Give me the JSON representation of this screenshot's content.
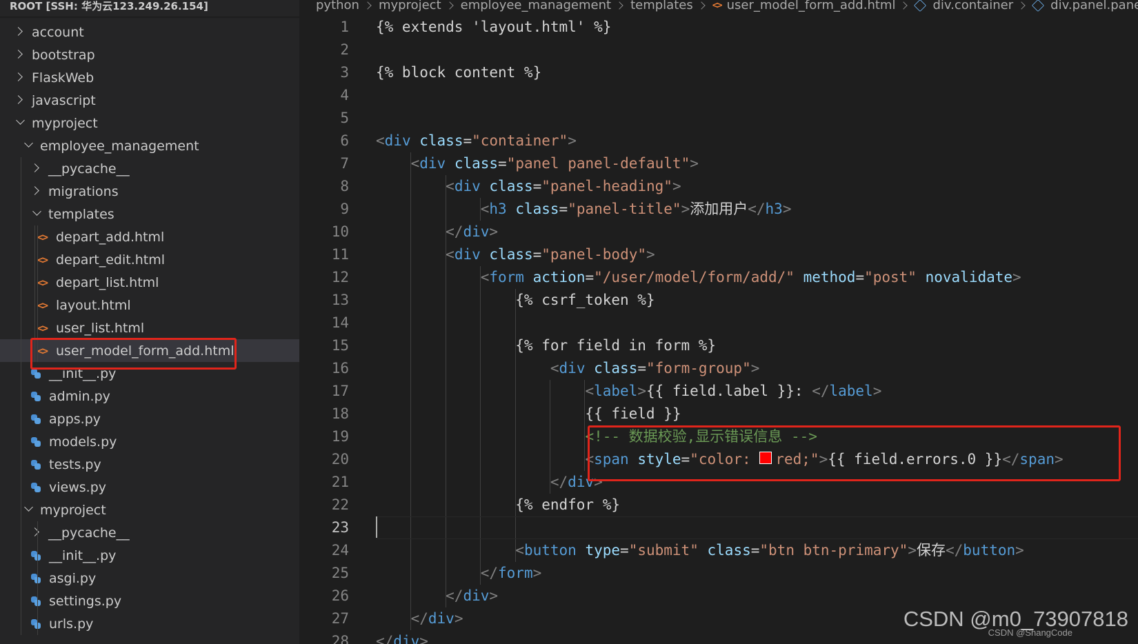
{
  "explorer": {
    "root_title": "ROOT [SSH: 华为云123.249.26.154]",
    "items": [
      {
        "label": "account",
        "kind": "folder",
        "state": "closed",
        "depth": 0
      },
      {
        "label": "bootstrap",
        "kind": "folder",
        "state": "closed",
        "depth": 0
      },
      {
        "label": "FlaskWeb",
        "kind": "folder",
        "state": "closed",
        "depth": 0
      },
      {
        "label": "javascript",
        "kind": "folder",
        "state": "closed",
        "depth": 0
      },
      {
        "label": "myproject",
        "kind": "folder",
        "state": "open",
        "depth": 0
      },
      {
        "label": "employee_management",
        "kind": "folder",
        "state": "open",
        "depth": 1
      },
      {
        "label": "__pycache__",
        "kind": "folder",
        "state": "closed",
        "depth": 2
      },
      {
        "label": "migrations",
        "kind": "folder",
        "state": "closed",
        "depth": 2
      },
      {
        "label": "templates",
        "kind": "folder",
        "state": "open",
        "depth": 2
      },
      {
        "label": "depart_add.html",
        "kind": "html",
        "depth": 3
      },
      {
        "label": "depart_edit.html",
        "kind": "html",
        "depth": 3
      },
      {
        "label": "depart_list.html",
        "kind": "html",
        "depth": 3
      },
      {
        "label": "layout.html",
        "kind": "html",
        "depth": 3
      },
      {
        "label": "user_list.html",
        "kind": "html",
        "depth": 3
      },
      {
        "label": "user_model_form_add.html",
        "kind": "html",
        "depth": 3,
        "selected": true
      },
      {
        "label": "__init__.py",
        "kind": "python",
        "depth": 2
      },
      {
        "label": "admin.py",
        "kind": "python",
        "depth": 2
      },
      {
        "label": "apps.py",
        "kind": "python",
        "depth": 2
      },
      {
        "label": "models.py",
        "kind": "python",
        "depth": 2
      },
      {
        "label": "tests.py",
        "kind": "python",
        "depth": 2
      },
      {
        "label": "views.py",
        "kind": "python",
        "depth": 2
      },
      {
        "label": "myproject",
        "kind": "folder",
        "state": "open",
        "depth": 1
      },
      {
        "label": "__pycache__",
        "kind": "folder",
        "state": "closed",
        "depth": 2
      },
      {
        "label": "__init__.py",
        "kind": "python",
        "depth": 2
      },
      {
        "label": "asgi.py",
        "kind": "python",
        "depth": 2
      },
      {
        "label": "settings.py",
        "kind": "python",
        "depth": 2
      },
      {
        "label": "urls.py",
        "kind": "python",
        "depth": 2
      }
    ]
  },
  "breadcrumb": [
    {
      "label": "python",
      "icon": ""
    },
    {
      "label": "myproject",
      "icon": ""
    },
    {
      "label": "employee_management",
      "icon": ""
    },
    {
      "label": "templates",
      "icon": ""
    },
    {
      "label": "user_model_form_add.html",
      "icon": "html-file-icon"
    },
    {
      "label": "div.container",
      "icon": "cube-icon"
    },
    {
      "label": "div.panel.panel-defa",
      "icon": "cube-icon"
    }
  ],
  "editor": {
    "active_line": 23,
    "lines": [
      {
        "n": "1",
        "tokens": [
          [
            "text",
            "{% extends 'layout.html' %}"
          ]
        ]
      },
      {
        "n": "2",
        "tokens": []
      },
      {
        "n": "3",
        "tokens": [
          [
            "text",
            "{% block content %}"
          ]
        ]
      },
      {
        "n": "4",
        "tokens": []
      },
      {
        "n": "5",
        "tokens": []
      },
      {
        "n": "6",
        "tokens": [
          [
            "punc",
            "<"
          ],
          [
            "tag",
            "div"
          ],
          [
            "text",
            " "
          ],
          [
            "attr",
            "class"
          ],
          [
            "text",
            "="
          ],
          [
            "str",
            "\"container\""
          ],
          [
            "punc",
            ">"
          ]
        ]
      },
      {
        "n": "7",
        "tokens": [
          [
            "text",
            "    "
          ],
          [
            "punc",
            "<"
          ],
          [
            "tag",
            "div"
          ],
          [
            "text",
            " "
          ],
          [
            "attr",
            "class"
          ],
          [
            "text",
            "="
          ],
          [
            "str",
            "\"panel panel-default\""
          ],
          [
            "punc",
            ">"
          ]
        ]
      },
      {
        "n": "8",
        "tokens": [
          [
            "text",
            "        "
          ],
          [
            "punc",
            "<"
          ],
          [
            "tag",
            "div"
          ],
          [
            "text",
            " "
          ],
          [
            "attr",
            "class"
          ],
          [
            "text",
            "="
          ],
          [
            "str",
            "\"panel-heading\""
          ],
          [
            "punc",
            ">"
          ]
        ]
      },
      {
        "n": "9",
        "tokens": [
          [
            "text",
            "            "
          ],
          [
            "punc",
            "<"
          ],
          [
            "tag",
            "h3"
          ],
          [
            "text",
            " "
          ],
          [
            "attr",
            "class"
          ],
          [
            "text",
            "="
          ],
          [
            "str",
            "\"panel-title\""
          ],
          [
            "punc",
            ">"
          ],
          [
            "text",
            "添加用户"
          ],
          [
            "punc",
            "</"
          ],
          [
            "tag",
            "h3"
          ],
          [
            "punc",
            ">"
          ]
        ]
      },
      {
        "n": "10",
        "tokens": [
          [
            "text",
            "        "
          ],
          [
            "punc",
            "</"
          ],
          [
            "tag",
            "div"
          ],
          [
            "punc",
            ">"
          ]
        ]
      },
      {
        "n": "11",
        "tokens": [
          [
            "text",
            "        "
          ],
          [
            "punc",
            "<"
          ],
          [
            "tag",
            "div"
          ],
          [
            "text",
            " "
          ],
          [
            "attr",
            "class"
          ],
          [
            "text",
            "="
          ],
          [
            "str",
            "\"panel-body\""
          ],
          [
            "punc",
            ">"
          ]
        ]
      },
      {
        "n": "12",
        "tokens": [
          [
            "text",
            "            "
          ],
          [
            "punc",
            "<"
          ],
          [
            "tag",
            "form"
          ],
          [
            "text",
            " "
          ],
          [
            "attr",
            "action"
          ],
          [
            "text",
            "="
          ],
          [
            "str",
            "\"/user/model/form/add/\""
          ],
          [
            "text",
            " "
          ],
          [
            "attr",
            "method"
          ],
          [
            "text",
            "="
          ],
          [
            "str",
            "\"post\""
          ],
          [
            "text",
            " "
          ],
          [
            "attr",
            "novalidate"
          ],
          [
            "punc",
            ">"
          ]
        ]
      },
      {
        "n": "13",
        "tokens": [
          [
            "text",
            "                {% csrf_token %}"
          ]
        ]
      },
      {
        "n": "14",
        "tokens": []
      },
      {
        "n": "15",
        "tokens": [
          [
            "text",
            "                {% for field in form %}"
          ]
        ]
      },
      {
        "n": "16",
        "tokens": [
          [
            "text",
            "                    "
          ],
          [
            "punc",
            "<"
          ],
          [
            "tag",
            "div"
          ],
          [
            "text",
            " "
          ],
          [
            "attr",
            "class"
          ],
          [
            "text",
            "="
          ],
          [
            "str",
            "\"form-group\""
          ],
          [
            "punc",
            ">"
          ]
        ]
      },
      {
        "n": "17",
        "tokens": [
          [
            "text",
            "                        "
          ],
          [
            "punc",
            "<"
          ],
          [
            "tag",
            "label"
          ],
          [
            "punc",
            ">"
          ],
          [
            "text",
            "{{ field.label }}: "
          ],
          [
            "punc",
            "</"
          ],
          [
            "tag",
            "label"
          ],
          [
            "punc",
            ">"
          ]
        ]
      },
      {
        "n": "18",
        "tokens": [
          [
            "text",
            "                        {{ field }}"
          ]
        ]
      },
      {
        "n": "19",
        "tokens": [
          [
            "text",
            "                        "
          ],
          [
            "comment",
            "<!-- 数据校验,显示错误信息 -->"
          ]
        ]
      },
      {
        "n": "20",
        "tokens": [
          [
            "text",
            "                        "
          ],
          [
            "punc",
            "<"
          ],
          [
            "tag",
            "span"
          ],
          [
            "text",
            " "
          ],
          [
            "attr",
            "style"
          ],
          [
            "text",
            "="
          ],
          [
            "str",
            "\"color: "
          ],
          [
            "swatch",
            "#ff0000"
          ],
          [
            "str",
            "red;\""
          ],
          [
            "punc",
            ">"
          ],
          [
            "text",
            "{{ field.errors.0 }}"
          ],
          [
            "punc",
            "</"
          ],
          [
            "tag",
            "span"
          ],
          [
            "punc",
            ">"
          ]
        ]
      },
      {
        "n": "21",
        "tokens": [
          [
            "text",
            "                    "
          ],
          [
            "punc",
            "</"
          ],
          [
            "tag",
            "div"
          ],
          [
            "punc",
            ">"
          ]
        ]
      },
      {
        "n": "22",
        "tokens": [
          [
            "text",
            "                {% endfor %}"
          ]
        ]
      },
      {
        "n": "23",
        "tokens": []
      },
      {
        "n": "24",
        "tokens": [
          [
            "text",
            "                "
          ],
          [
            "punc",
            "<"
          ],
          [
            "tag",
            "button"
          ],
          [
            "text",
            " "
          ],
          [
            "attr",
            "type"
          ],
          [
            "text",
            "="
          ],
          [
            "str",
            "\"submit\""
          ],
          [
            "text",
            " "
          ],
          [
            "attr",
            "class"
          ],
          [
            "text",
            "="
          ],
          [
            "str",
            "\"btn btn-primary\""
          ],
          [
            "punc",
            ">"
          ],
          [
            "text",
            "保存"
          ],
          [
            "punc",
            "</"
          ],
          [
            "tag",
            "button"
          ],
          [
            "punc",
            ">"
          ]
        ]
      },
      {
        "n": "25",
        "tokens": [
          [
            "text",
            "            "
          ],
          [
            "punc",
            "</"
          ],
          [
            "tag",
            "form"
          ],
          [
            "punc",
            ">"
          ]
        ]
      },
      {
        "n": "26",
        "tokens": [
          [
            "text",
            "        "
          ],
          [
            "punc",
            "</"
          ],
          [
            "tag",
            "div"
          ],
          [
            "punc",
            ">"
          ]
        ]
      },
      {
        "n": "27",
        "tokens": [
          [
            "text",
            "    "
          ],
          [
            "punc",
            "</"
          ],
          [
            "tag",
            "div"
          ],
          [
            "punc",
            ">"
          ]
        ]
      },
      {
        "n": "28",
        "tokens": [
          [
            "punc",
            "</"
          ],
          [
            "tag",
            "div"
          ],
          [
            "punc",
            ">"
          ]
        ]
      }
    ]
  },
  "watermark": {
    "main": "CSDN @m0_73907818",
    "small": "CSDN @ShangCode"
  },
  "colors": {
    "highlight_box": "#e1251b",
    "tag": "#569cd6",
    "attribute": "#9cdcfe",
    "string": "#ce9178",
    "comment": "#6a9955"
  }
}
